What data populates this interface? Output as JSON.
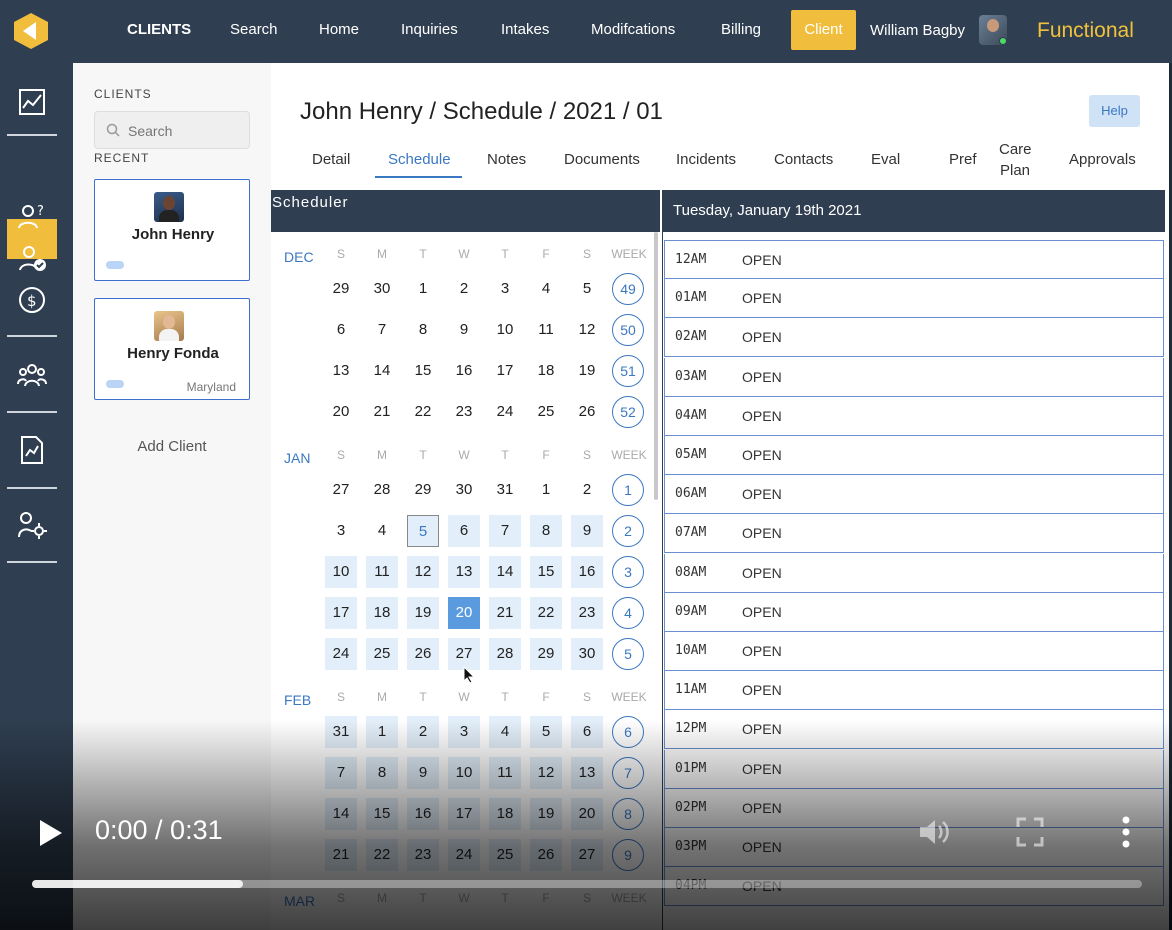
{
  "topnav": {
    "items": [
      "CLIENTS",
      "Search",
      "Home",
      "Inquiries",
      "Intakes",
      "Modifcations",
      "Billing"
    ],
    "active_item": "Client",
    "user_name": "William Bagby",
    "brand": "Functional",
    "accent_color": "#f0bd3c"
  },
  "rail": {
    "icons": [
      "dashboard-chart-icon",
      "client-profile-icon",
      "inquiries-icon",
      "user-check-icon",
      "billing-icon",
      "team-icon",
      "report-icon",
      "settings-user-icon"
    ]
  },
  "clients_panel": {
    "section_label": "CLIENTS",
    "search_placeholder": "Search",
    "recent_label": "RECENT",
    "cards": [
      {
        "name": "John Henry",
        "state": ""
      },
      {
        "name": "Henry Fonda",
        "state": "Maryland"
      }
    ],
    "add_client": "Add Client"
  },
  "main": {
    "title": "John Henry / Schedule / 2021 / 01",
    "help": "Help",
    "tabs": [
      "Detail",
      "Schedule",
      "Notes",
      "Documents",
      "Incidents",
      "Contacts",
      "Eval",
      "Pref",
      "Care Plan",
      "Approvals"
    ],
    "active_tab": "Schedule"
  },
  "scheduler": {
    "title": "Scheduler",
    "dow": [
      "S",
      "M",
      "T",
      "W",
      "T",
      "F",
      "S",
      "WEEK"
    ],
    "months": [
      {
        "label": "DEC",
        "weeks": [
          {
            "days": [
              "29",
              "30",
              "1",
              "2",
              "3",
              "4",
              "5"
            ],
            "week": "49"
          },
          {
            "days": [
              "6",
              "7",
              "8",
              "9",
              "10",
              "11",
              "12"
            ],
            "week": "50"
          },
          {
            "days": [
              "13",
              "14",
              "15",
              "16",
              "17",
              "18",
              "19"
            ],
            "week": "51"
          },
          {
            "days": [
              "20",
              "21",
              "22",
              "23",
              "24",
              "25",
              "26"
            ],
            "week": "52"
          }
        ]
      },
      {
        "label": "JAN",
        "weeks": [
          {
            "days": [
              "27",
              "28",
              "29",
              "30",
              "31",
              "1",
              "2"
            ],
            "week": "1"
          },
          {
            "days": [
              "3",
              "4",
              "5",
              "6",
              "7",
              "8",
              "9"
            ],
            "week": "2"
          },
          {
            "days": [
              "10",
              "11",
              "12",
              "13",
              "14",
              "15",
              "16"
            ],
            "week": "3"
          },
          {
            "days": [
              "17",
              "18",
              "19",
              "20",
              "21",
              "22",
              "23"
            ],
            "week": "4"
          },
          {
            "days": [
              "24",
              "25",
              "26",
              "27",
              "28",
              "29",
              "30"
            ],
            "week": "5"
          }
        ]
      },
      {
        "label": "FEB",
        "weeks": [
          {
            "days": [
              "31",
              "1",
              "2",
              "3",
              "4",
              "5",
              "6"
            ],
            "week": "6"
          },
          {
            "days": [
              "7",
              "8",
              "9",
              "10",
              "11",
              "12",
              "13"
            ],
            "week": "7"
          },
          {
            "days": [
              "14",
              "15",
              "16",
              "17",
              "18",
              "19",
              "20"
            ],
            "week": "8"
          },
          {
            "days": [
              "21",
              "22",
              "23",
              "24",
              "25",
              "26",
              "27"
            ],
            "week": "9"
          }
        ]
      },
      {
        "label": "MAR",
        "weeks": []
      }
    ],
    "today": "5",
    "selected": "20"
  },
  "day_view": {
    "heading": "Tuesday, January 19th 2021",
    "slots": [
      {
        "time": "12AM",
        "status": "OPEN"
      },
      {
        "time": "01AM",
        "status": "OPEN"
      },
      {
        "time": "02AM",
        "status": "OPEN"
      },
      {
        "time": "03AM",
        "status": "OPEN"
      },
      {
        "time": "04AM",
        "status": "OPEN"
      },
      {
        "time": "05AM",
        "status": "OPEN"
      },
      {
        "time": "06AM",
        "status": "OPEN"
      },
      {
        "time": "07AM",
        "status": "OPEN"
      },
      {
        "time": "08AM",
        "status": "OPEN"
      },
      {
        "time": "09AM",
        "status": "OPEN"
      },
      {
        "time": "10AM",
        "status": "OPEN"
      },
      {
        "time": "11AM",
        "status": "OPEN"
      },
      {
        "time": "12PM",
        "status": "OPEN"
      },
      {
        "time": "01PM",
        "status": "OPEN"
      },
      {
        "time": "02PM",
        "status": "OPEN"
      },
      {
        "time": "03PM",
        "status": "OPEN"
      },
      {
        "time": "04PM",
        "status": "OPEN"
      }
    ]
  },
  "video": {
    "time": "0:00 / 0:31",
    "progress": 0.19
  }
}
